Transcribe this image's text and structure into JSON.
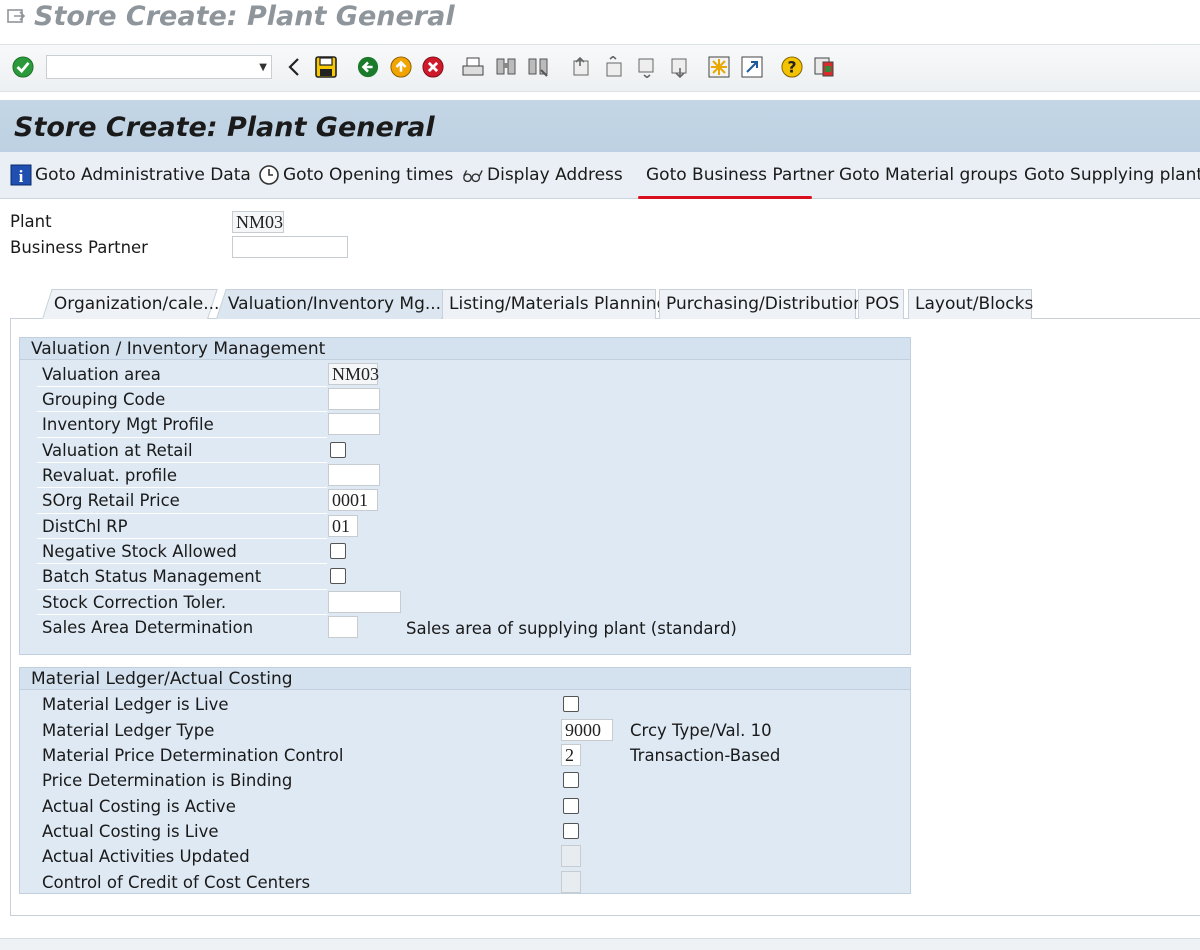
{
  "window": {
    "title": "Store Create: Plant General"
  },
  "system_toolbar": {
    "command_field_value": "",
    "icons": [
      "enter-icon",
      "back-arrow-icon",
      "save-icon",
      "back-icon",
      "exit-icon",
      "cancel-icon",
      "print-icon",
      "find-icon",
      "find-next-icon",
      "first-page-icon",
      "previous-page-icon",
      "next-page-icon",
      "last-page-icon",
      "create-session-icon",
      "shortcut-icon",
      "help-icon",
      "customize-layout-icon"
    ]
  },
  "page": {
    "title": "Store Create: Plant General"
  },
  "app_toolbar": {
    "admin_data": "Goto Administrative Data",
    "opening_times": "Goto Opening times",
    "display_address": "Display Address",
    "business_partner": "Goto Business Partner",
    "material_groups": "Goto Material groups",
    "supplying_plants": "Goto Supplying plants"
  },
  "header": {
    "plant_label": "Plant",
    "plant_value": "NM03",
    "bp_label": "Business Partner",
    "bp_value": ""
  },
  "tabs": [
    {
      "label": "Organization/cale...",
      "active": false
    },
    {
      "label": "Valuation/Inventory Mg...",
      "active": true
    },
    {
      "label": "Listing/Materials Planning",
      "active": false
    },
    {
      "label": "Purchasing/Distribution",
      "active": false
    },
    {
      "label": "POS",
      "active": false
    },
    {
      "label": "Layout/Blocks",
      "active": false
    }
  ],
  "valuation_group": {
    "title": "Valuation / Inventory Management",
    "fields": [
      {
        "label": "Valuation area",
        "value": "NM03"
      },
      {
        "label": "Grouping Code",
        "value": ""
      },
      {
        "label": "Inventory Mgt Profile",
        "value": ""
      },
      {
        "label": "Valuation at Retail",
        "checked": false
      },
      {
        "label": "Revaluat. profile",
        "value": ""
      },
      {
        "label": "SOrg Retail Price",
        "value": "0001"
      },
      {
        "label": "DistChl RP",
        "value": "01"
      },
      {
        "label": "Negative Stock Allowed",
        "checked": false
      },
      {
        "label": "Batch Status Management",
        "checked": false
      },
      {
        "label": "Stock Correction Toler.",
        "value": ""
      },
      {
        "label": "Sales Area Determination",
        "value": "",
        "description": "Sales area of supplying plant (standard)"
      }
    ]
  },
  "ledger_group": {
    "title": "Material Ledger/Actual Costing",
    "fields": [
      {
        "label": "Material Ledger is Live",
        "checked": false
      },
      {
        "label": "Material Ledger Type",
        "value": "9000",
        "description": "Crcy Type/Val. 10"
      },
      {
        "label": "Material Price Determination Control",
        "value": "2",
        "description": "Transaction-Based"
      },
      {
        "label": "Price Determination is Binding",
        "checked": false
      },
      {
        "label": "Actual Costing is Active",
        "checked": false
      },
      {
        "label": "Actual Costing is Live",
        "checked": false
      },
      {
        "label": "Actual Activities Updated",
        "value": ""
      },
      {
        "label": "Control of Credit of Cost Centers",
        "value": ""
      }
    ]
  },
  "colors": {
    "header_bg": "#c4d6e6",
    "group_bg": "#dee9f4",
    "highlight_underline": "#d90f1f"
  }
}
